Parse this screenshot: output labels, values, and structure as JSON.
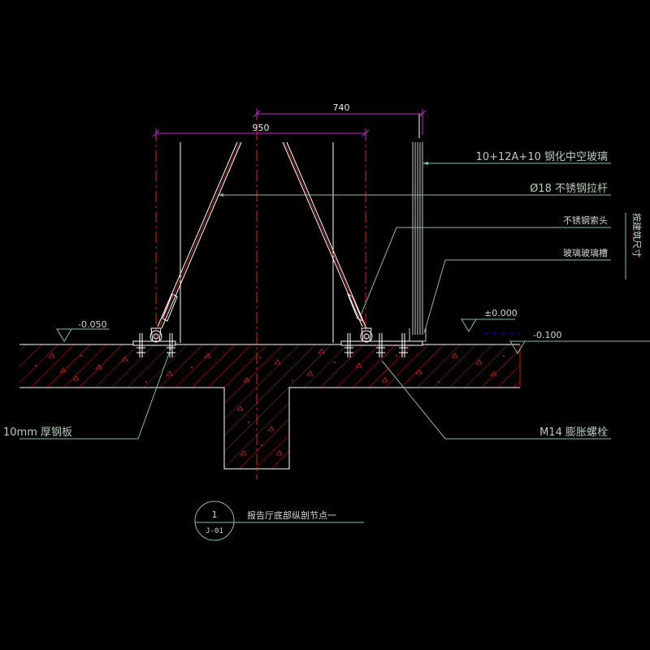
{
  "colors": {
    "background": "#000000",
    "leader": "#7fbfa8",
    "dimension": "#d020d0",
    "centerline": "#e02020",
    "concrete_hatch": "#d01818",
    "outline": "#ffffff",
    "text": "#cfd8d0",
    "elevation_mark": "#0000ff"
  },
  "dimensions": {
    "top": "740",
    "lower": "950"
  },
  "labels": {
    "glass": "10+12A+10 钢化中空玻璃",
    "rod": "Ø18 不锈钢拉杆",
    "cable_head": "不锈钢索头",
    "glass_slot": "玻璃玻璃槽",
    "vertical": "按建筑尺寸",
    "plate": "10mm 厚钢板",
    "bolt": "M14 膨胀螺栓"
  },
  "elevations": {
    "left": "-0.050",
    "center": "±0.000",
    "right": "-0.100"
  },
  "detail_tag": {
    "number": "1",
    "sheet": "J-01",
    "title": "报告厅底部纵剖节点一"
  }
}
